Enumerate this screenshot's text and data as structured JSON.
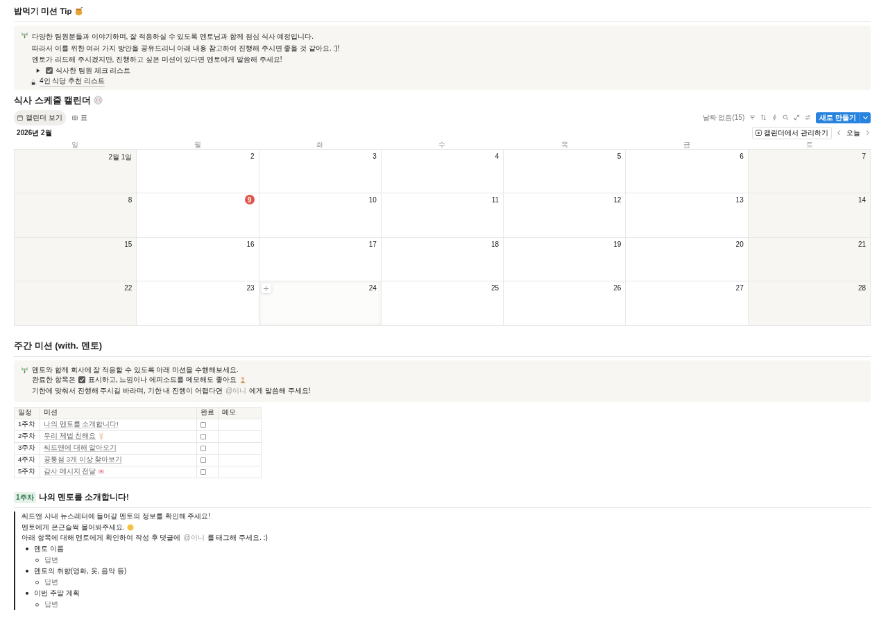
{
  "tip_section": {
    "title": "밥먹기 미션 Tip",
    "callout": {
      "lines": [
        [
          {
            "kind": "text",
            "text": "다양한 팀원분들과 이야기하며, 잘 적응하실 수 있도록 멘토님과 함께 점심 식사 예정입니다."
          }
        ],
        [
          {
            "kind": "text",
            "text": "따라서 이를 위한 여러 가지 방안을 공유드리니 아래 내용 참고하여 진행해 주시면 좋을 것 같아요. :)!"
          }
        ],
        [
          {
            "kind": "text",
            "text": "멘토가 리드해 주시겠지만, 진행하고 싶은 미션이 있다면 멘토에게 말씀해 주세요!"
          }
        ]
      ],
      "toggles": [
        {
          "kind": "toggle",
          "label": "식사한 팀원 체크 리스트",
          "expanded": false
        },
        {
          "kind": "page",
          "label": "4인 식당 추천 리스트"
        }
      ]
    }
  },
  "calendar_section": {
    "title": "식사 스케줄 캘린더",
    "views": [
      {
        "label": "캘린더 보기",
        "selected": true
      },
      {
        "label": "표",
        "selected": false
      }
    ],
    "no_date": "날짜 없음(15)",
    "new_button": "새로 만들기",
    "month": "2026년 2월",
    "manage_button": "캘린더에서 관리하기",
    "today_button": "오늘",
    "weekdays": [
      "일",
      "월",
      "화",
      "수",
      "목",
      "금",
      "토"
    ],
    "weeks": [
      [
        {
          "label": "2월 1일",
          "today": false,
          "hovered": false
        },
        {
          "label": "2",
          "today": false,
          "hovered": false
        },
        {
          "label": "3",
          "today": false,
          "hovered": false
        },
        {
          "label": "4",
          "today": false,
          "hovered": false
        },
        {
          "label": "5",
          "today": false,
          "hovered": false
        },
        {
          "label": "6",
          "today": false,
          "hovered": false
        },
        {
          "label": "7",
          "today": false,
          "hovered": false
        }
      ],
      [
        {
          "label": "8",
          "today": false,
          "hovered": false
        },
        {
          "label": "9",
          "today": true,
          "hovered": false
        },
        {
          "label": "10",
          "today": false,
          "hovered": false
        },
        {
          "label": "11",
          "today": false,
          "hovered": false
        },
        {
          "label": "12",
          "today": false,
          "hovered": false
        },
        {
          "label": "13",
          "today": false,
          "hovered": false
        },
        {
          "label": "14",
          "today": false,
          "hovered": false
        }
      ],
      [
        {
          "label": "15",
          "today": false,
          "hovered": false
        },
        {
          "label": "16",
          "today": false,
          "hovered": false
        },
        {
          "label": "17",
          "today": false,
          "hovered": false
        },
        {
          "label": "18",
          "today": false,
          "hovered": false
        },
        {
          "label": "19",
          "today": false,
          "hovered": false
        },
        {
          "label": "20",
          "today": false,
          "hovered": false
        },
        {
          "label": "21",
          "today": false,
          "hovered": false
        }
      ],
      [
        {
          "label": "22",
          "today": false,
          "hovered": false
        },
        {
          "label": "23",
          "today": false,
          "hovered": false
        },
        {
          "label": "24",
          "today": false,
          "hovered": true
        },
        {
          "label": "25",
          "today": false,
          "hovered": false
        },
        {
          "label": "26",
          "today": false,
          "hovered": false
        },
        {
          "label": "27",
          "today": false,
          "hovered": false
        },
        {
          "label": "28",
          "today": false,
          "hovered": false
        }
      ]
    ]
  },
  "weekly_section": {
    "title": "주간 미션 (with. 멘토)",
    "callout": {
      "lines": [
        [
          {
            "kind": "text",
            "text": "멘토와 함께 회사에 잘 적응할 수 있도록 아래 미션을 수행해보세요."
          }
        ],
        [
          {
            "kind": "text",
            "text": "완료한 항목은"
          },
          {
            "kind": "check"
          },
          {
            "kind": "text",
            "text": "표시하고, 느낌이나 에피소드를 메모해도 좋아요"
          },
          {
            "kind": "emoji"
          }
        ],
        [
          {
            "kind": "text",
            "text": "기한에 맞춰서 진행해 주시길 바라며, 기한 내 진행이 어렵다면"
          },
          {
            "kind": "mention",
            "text": "@이니"
          },
          {
            "kind": "text",
            "text": "에게 말씀해 주세요!"
          }
        ]
      ]
    },
    "table": {
      "columns": [
        "일정",
        "미션",
        "완료",
        "메모"
      ],
      "rows": [
        {
          "schedule": "1주차",
          "mission": "나의 멘토를 소개합니다!",
          "kind": "plain",
          "done": false
        },
        {
          "schedule": "2주차",
          "mission": "우리 제법 친해요",
          "kind": "hand",
          "done": false
        },
        {
          "schedule": "3주차",
          "mission": "씨드앤에 대해 알아오기",
          "kind": "plain",
          "done": false
        },
        {
          "schedule": "4주차",
          "mission": "공통점 3개 이상 찾아보기",
          "kind": "plain",
          "done": false
        },
        {
          "schedule": "5주차",
          "mission": "감사 메시지 전달",
          "kind": "letter",
          "done": false
        }
      ]
    }
  },
  "week1_section": {
    "tag": "1주차",
    "title": "나의 멘토를 소개합니다!",
    "lines": [
      [
        {
          "kind": "text",
          "text": "씨드앤 사내 뉴스레터에 들어갈 멘토의 정보를 확인해 주세요!"
        }
      ],
      [
        {
          "kind": "text",
          "text": "멘토에게 은근슬쩍 물어봐주세요."
        },
        {
          "kind": "emoji"
        }
      ],
      [
        {
          "kind": "text",
          "text": "아래 항목에 대해 멘토에게 확인하여 작성 후 댓글에"
        },
        {
          "kind": "mention",
          "text": "@이니"
        },
        {
          "kind": "text",
          "text": "를 태그해 주세요. :)"
        }
      ]
    ],
    "bullets": [
      {
        "text": "멘토 이름",
        "children": [
          {
            "text": "답변"
          }
        ]
      },
      {
        "text": "멘토의 취향(영화, 옷, 음악 등)",
        "children": [
          {
            "text": "답변"
          }
        ]
      },
      {
        "text": "이번 주말 계획",
        "children": [
          {
            "text": "답변"
          }
        ]
      }
    ]
  }
}
